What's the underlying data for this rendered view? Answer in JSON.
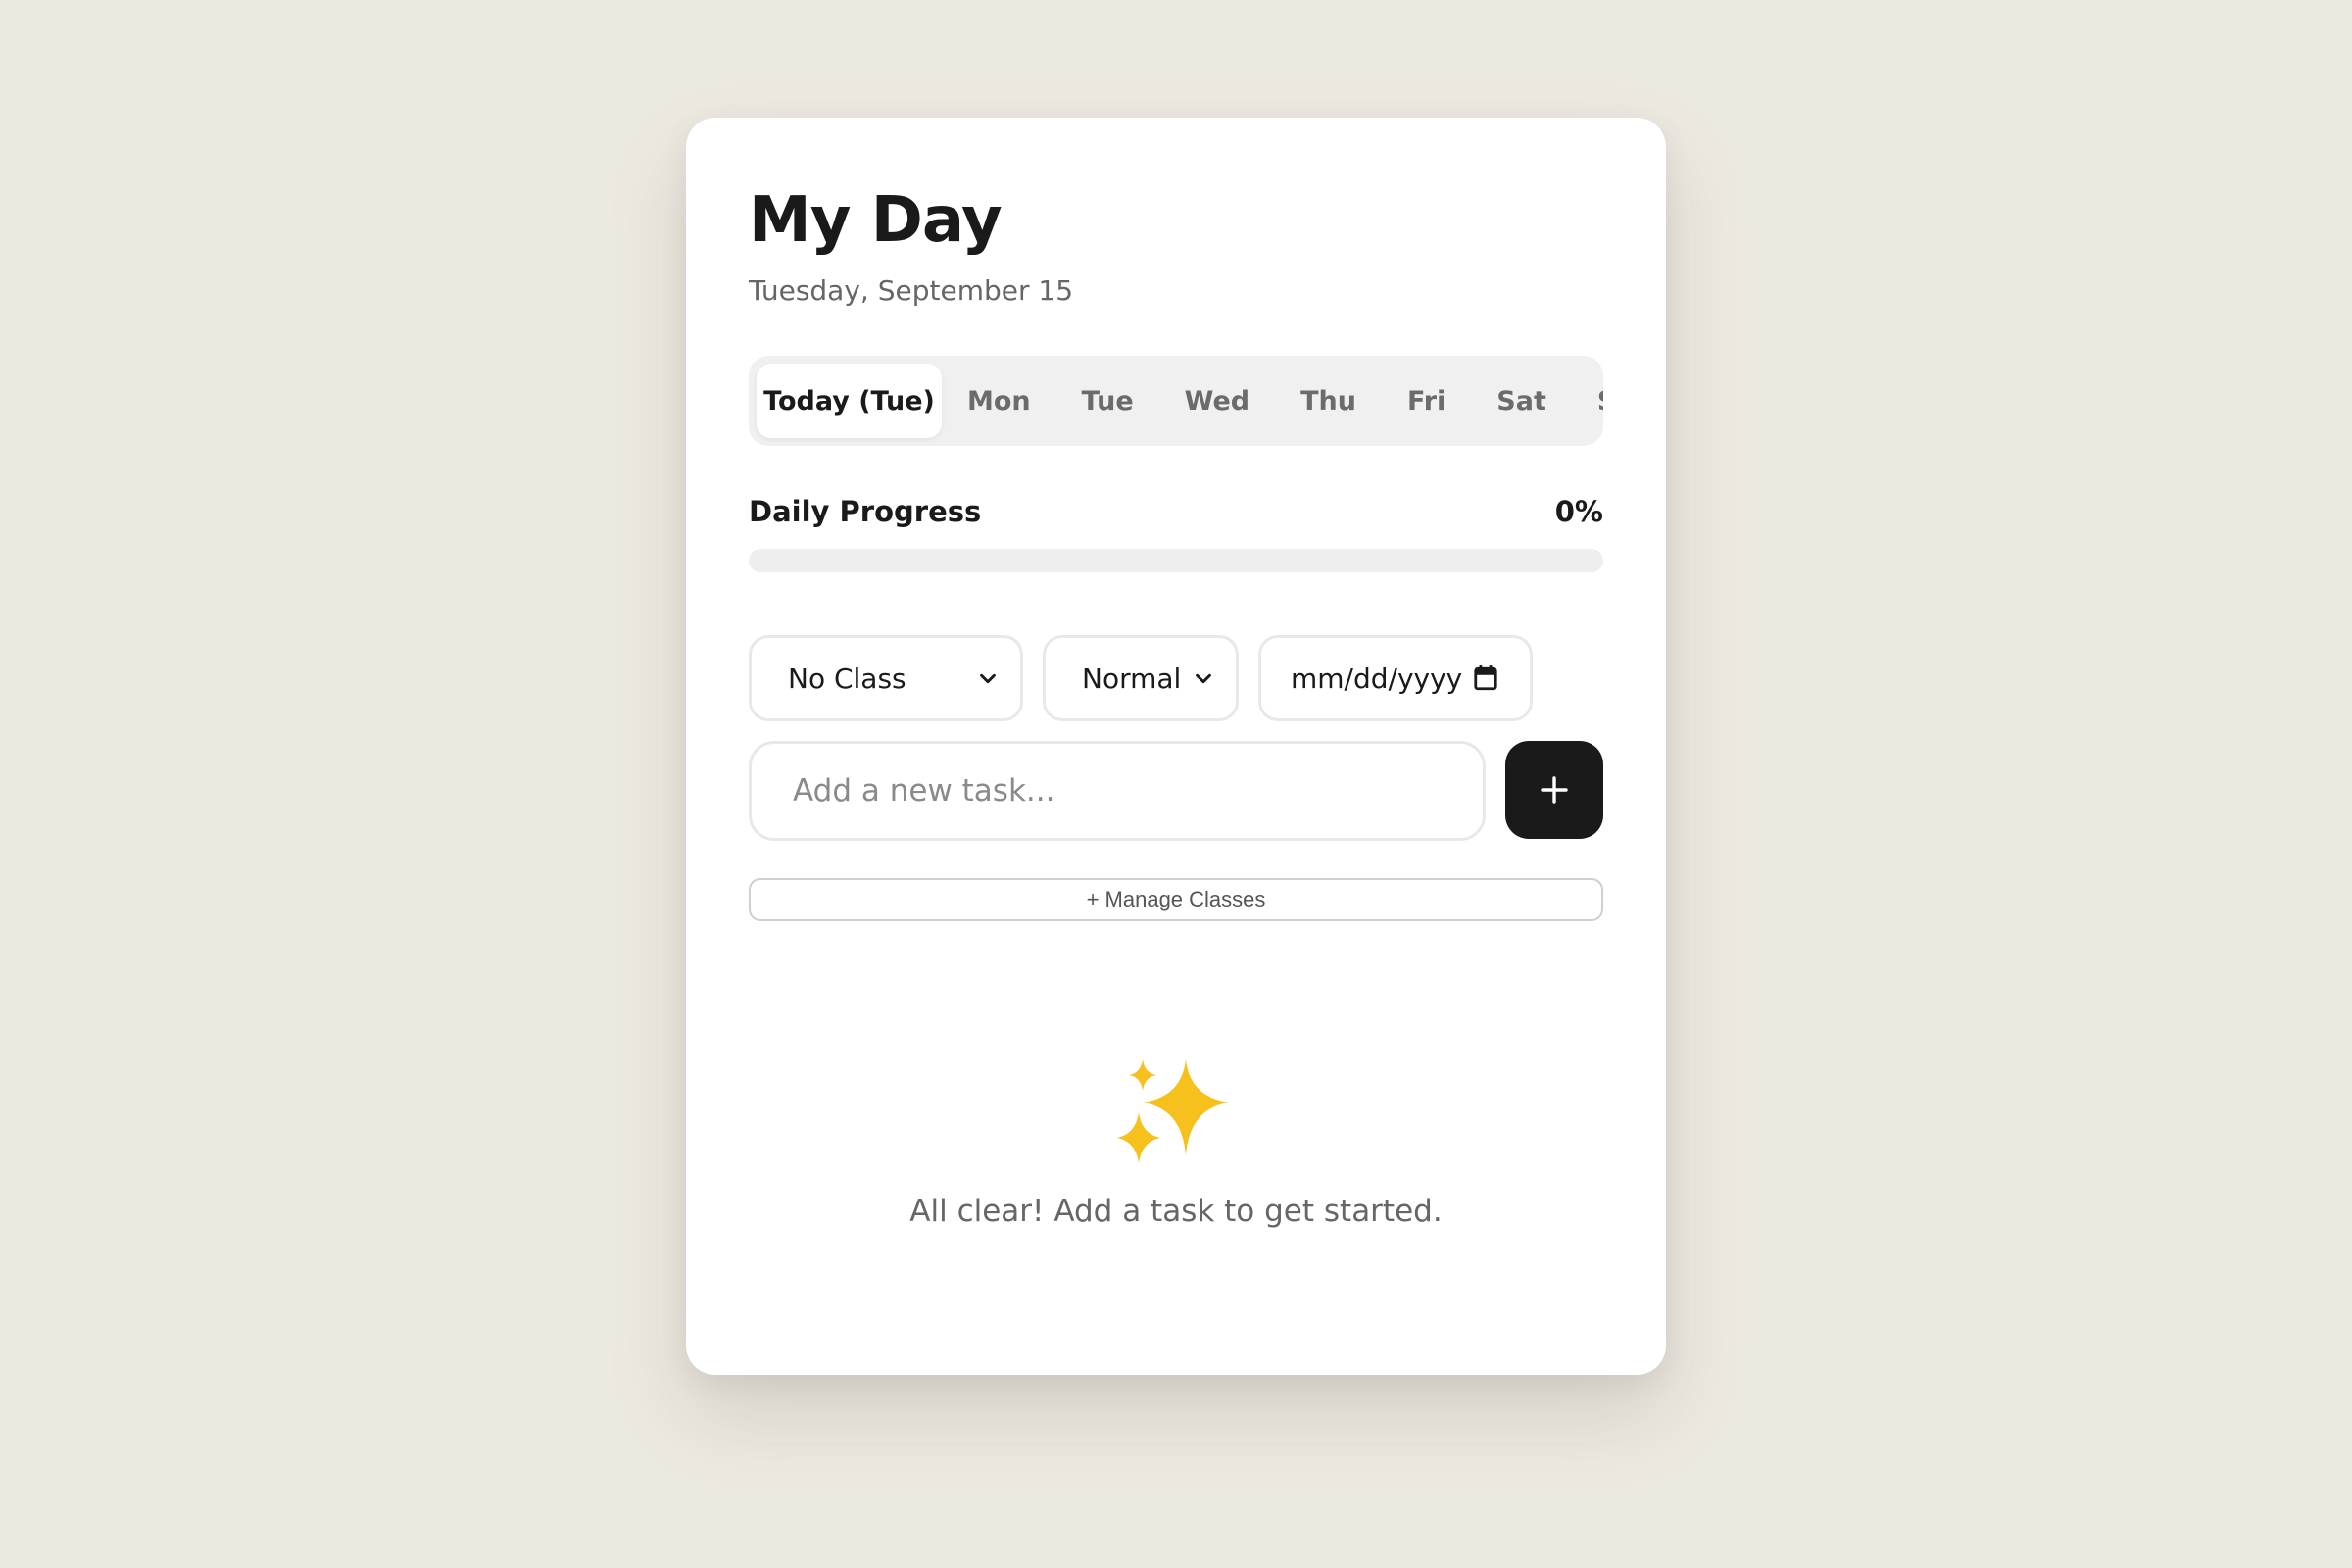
{
  "header": {
    "title": "My Day",
    "date": "Tuesday, September 15"
  },
  "tabs": [
    {
      "label": "Today (Tue)",
      "active": true
    },
    {
      "label": "Mon",
      "active": false
    },
    {
      "label": "Tue",
      "active": false
    },
    {
      "label": "Wed",
      "active": false
    },
    {
      "label": "Thu",
      "active": false
    },
    {
      "label": "Fri",
      "active": false
    },
    {
      "label": "Sat",
      "active": false
    },
    {
      "label": "Sun",
      "active": false
    }
  ],
  "progress": {
    "label": "Daily Progress",
    "value_text": "0%",
    "percent": 0
  },
  "form": {
    "class_select": {
      "selected": "No Class",
      "icon": "chevron-down-icon"
    },
    "priority_select": {
      "selected": "Normal",
      "icon": "chevron-down-icon"
    },
    "due_date": {
      "placeholder": "mm/dd/yyyy",
      "icon": "calendar-icon"
    },
    "task_input": {
      "placeholder": "Add a new task..."
    },
    "add_button": {
      "icon": "plus-icon"
    },
    "manage_classes_label": "+ Manage Classes"
  },
  "empty_state": {
    "icon": "sparkles-icon",
    "message": "All clear! Add a task to get started."
  },
  "colors": {
    "background": "#ece9e1",
    "card": "#ffffff",
    "accent": "#1a1a1a",
    "sparkle": "#f6c11c"
  }
}
